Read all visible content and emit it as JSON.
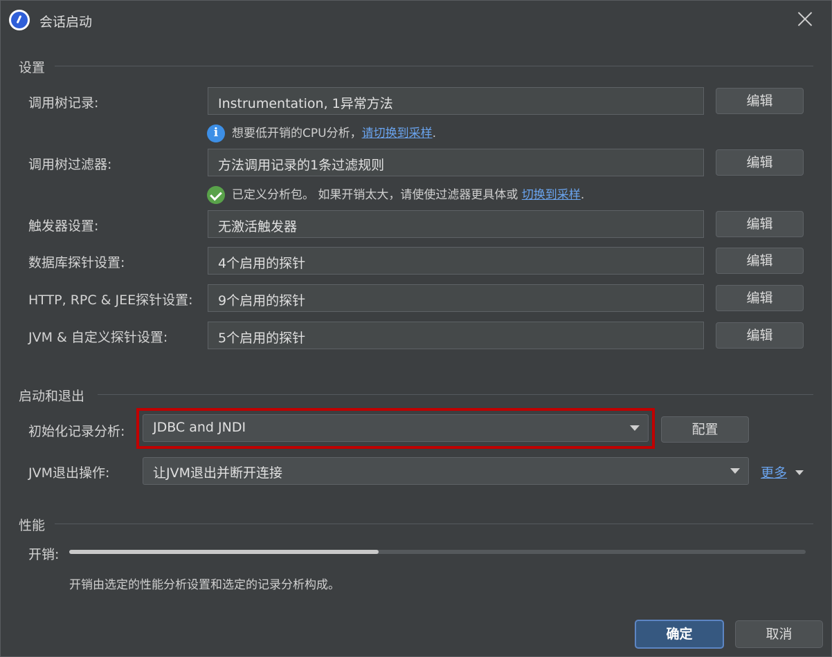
{
  "window": {
    "title": "会话启动"
  },
  "sections": {
    "settings": "设置",
    "startup": "启动和退出",
    "performance": "性能"
  },
  "settings": {
    "rows": [
      {
        "label": "调用树记录:",
        "value": "Instrumentation, 1异常方法",
        "button": "编辑"
      },
      {
        "label": "调用树过滤器:",
        "value": "方法调用记录的1条过滤规则",
        "button": "编辑"
      },
      {
        "label": "触发器设置:",
        "value": "无激活触发器",
        "button": "编辑"
      },
      {
        "label": "数据库探针设置:",
        "value": "4个启用的探针",
        "button": "编辑"
      },
      {
        "label": "HTTP, RPC & JEE探针设置:",
        "value": "9个启用的探针",
        "button": "编辑"
      },
      {
        "label": "JVM & 自定义探针设置:",
        "value": "5个启用的探针",
        "button": "编辑"
      }
    ],
    "hint_cpu": {
      "text": "想要低开销的CPU分析，",
      "link": "请切换到采样",
      "suffix": "."
    },
    "hint_filter": {
      "text": "已定义分析包。 如果开销太大，请使使过滤器更具体或 ",
      "link": "切换到采样",
      "suffix": "."
    }
  },
  "startup": {
    "init_label": "初始化记录分析:",
    "init_value": "JDBC and JNDI",
    "config_button": "配置",
    "exit_label": "JVM退出操作:",
    "exit_value": "让JVM退出并断开连接",
    "more_link": "更多"
  },
  "performance": {
    "overhead_label": "开销:",
    "overhead_level": 0.42,
    "description": "开销由选定的性能分析设置和选定的记录分析构成。"
  },
  "footer": {
    "ok": "确定",
    "cancel": "取消"
  }
}
